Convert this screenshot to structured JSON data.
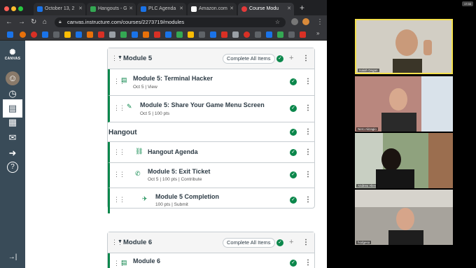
{
  "browser": {
    "tabs": [
      {
        "label": "October 13, 2",
        "active": false,
        "favicon_color": "#1a73e8"
      },
      {
        "label": "Hangouts - G",
        "active": false,
        "favicon_color": "#34a853"
      },
      {
        "label": "PLC Agenda",
        "active": false,
        "favicon_color": "#1a73e8"
      },
      {
        "label": "Amazon.com",
        "active": false,
        "favicon_color": "#ffffff"
      },
      {
        "label": "Course Modu",
        "active": true,
        "favicon_color": "#e33a3a"
      }
    ],
    "new_tab": "+",
    "url": "canvas.instructure.com/courses/2273719/modules"
  },
  "canvas_nav": {
    "logo_text": "CANVAS",
    "items": [
      {
        "name": "account",
        "glyph": "☺"
      },
      {
        "name": "dashboard",
        "glyph": "◷"
      },
      {
        "name": "courses",
        "glyph": "▤",
        "active": true
      },
      {
        "name": "calendar",
        "glyph": "▦"
      },
      {
        "name": "inbox",
        "glyph": "✉"
      },
      {
        "name": "commons",
        "glyph": "➜"
      },
      {
        "name": "help",
        "glyph": "?"
      }
    ],
    "collapse_glyph": "→|"
  },
  "modules": [
    {
      "title": "Module 5",
      "complete_all_label": "Complete All Items",
      "items": [
        {
          "type": "page",
          "title": "Module 5: Terminal Hacker",
          "meta": "Oct 5  |  View",
          "completed": true
        },
        {
          "type": "assignment",
          "title": "Module 5: Share Your Game Menu Screen",
          "meta": "Oct 5  |  100 pts",
          "completed": true
        },
        {
          "type": "header",
          "title": "Hangout",
          "completed": true
        },
        {
          "type": "link",
          "title": "Hangout Agenda",
          "meta": "",
          "completed": true
        },
        {
          "type": "discussion",
          "title": "Module 5: Exit Ticket",
          "meta": "Oct 5  |  100 pts  |  Contribute",
          "completed": true
        },
        {
          "type": "quiz",
          "title": "Module 5 Completion",
          "meta": "100 pts  |  Submit",
          "completed": true
        }
      ]
    },
    {
      "title": "Module 6",
      "complete_all_label": "Complete All Items",
      "items": [
        {
          "type": "page",
          "title": "Module 6",
          "meta": "",
          "completed": true
        }
      ]
    }
  ],
  "video_call": {
    "clock": "17:33",
    "participants": [
      {
        "name": "Isaiah Degan",
        "active_speaker": true,
        "bg": "#c9c4b8"
      },
      {
        "name": "Nero Akzagio",
        "active_speaker": false,
        "bg": "#b9877e"
      },
      {
        "name": "Andrew Allen",
        "active_speaker": false,
        "bg": "#7d8a6e"
      },
      {
        "name": "hodgesa",
        "active_speaker": false,
        "bg": "#a7a39c"
      }
    ]
  },
  "colors": {
    "success": "#0b874b",
    "sidebar": "#394b58",
    "active_speaker": "#f4e04d"
  }
}
